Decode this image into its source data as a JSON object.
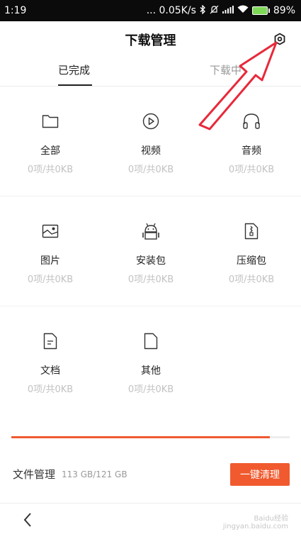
{
  "status_bar": {
    "time": "1:19",
    "network_speed": "... 0.05K/s",
    "battery": "89%",
    "battery_color": "#7ed957"
  },
  "header": {
    "title": "下载管理",
    "settings_icon": "gear-icon"
  },
  "tabs": [
    {
      "label": "已完成",
      "active": true
    },
    {
      "label": "下载中",
      "active": false
    }
  ],
  "categories": [
    {
      "name": "全部",
      "meta": "0项/共0KB",
      "icon": "folder-icon"
    },
    {
      "name": "视频",
      "meta": "0项/共0KB",
      "icon": "video-play-icon"
    },
    {
      "name": "音频",
      "meta": "0项/共0KB",
      "icon": "headphones-icon"
    },
    {
      "name": "图片",
      "meta": "0项/共0KB",
      "icon": "image-icon"
    },
    {
      "name": "安装包",
      "meta": "0项/共0KB",
      "icon": "android-icon"
    },
    {
      "name": "压缩包",
      "meta": "0项/共0KB",
      "icon": "zip-file-icon"
    },
    {
      "name": "文档",
      "meta": "0项/共0KB",
      "icon": "document-icon"
    },
    {
      "name": "其他",
      "meta": "0项/共0KB",
      "icon": "file-icon"
    }
  ],
  "storage": {
    "label": "文件管理",
    "usage": "113 GB/121 GB",
    "used_fraction": 0.93,
    "bar_color": "#ef5a32"
  },
  "clean_button": {
    "label": "一键清理",
    "color": "#f05a2e"
  },
  "nav": {
    "back_icon": "back-arrow-icon"
  },
  "annotation": {
    "color": "#e8293a"
  },
  "watermark": {
    "text": "Baidu经验",
    "subtext": "jingyan.baidu.com"
  }
}
